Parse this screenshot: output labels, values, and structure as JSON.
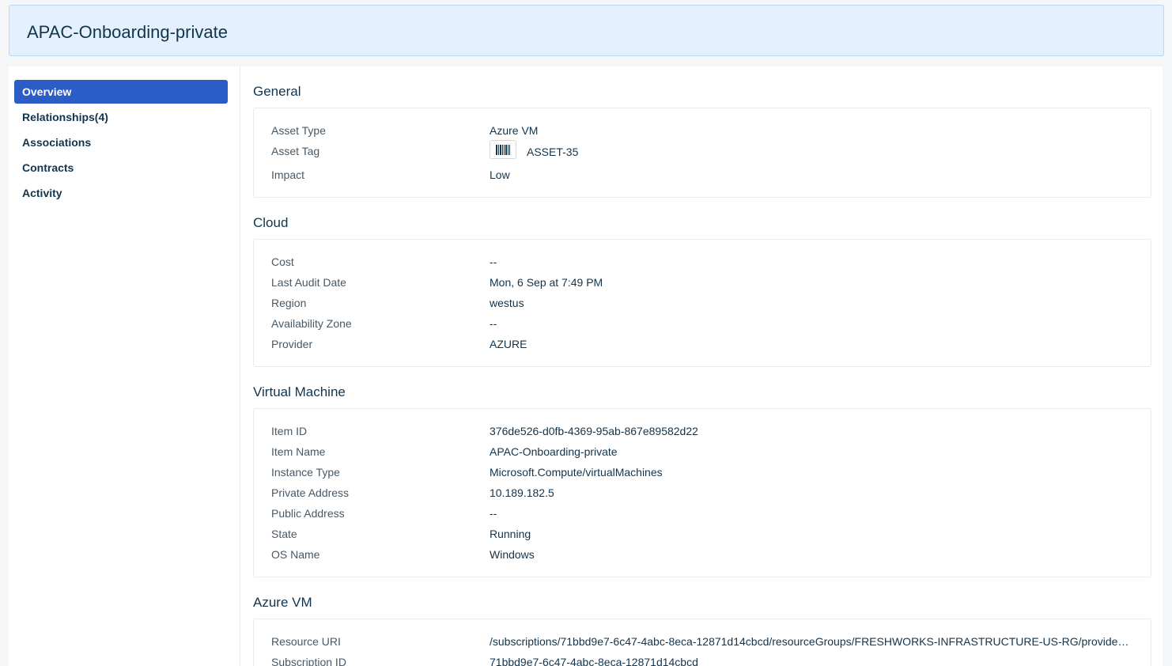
{
  "header": {
    "title": "APAC-Onboarding-private"
  },
  "sidebar": {
    "items": [
      {
        "label": "Overview",
        "active": true
      },
      {
        "label": "Relationships(4)",
        "active": false
      },
      {
        "label": "Associations",
        "active": false
      },
      {
        "label": "Contracts",
        "active": false
      },
      {
        "label": "Activity",
        "active": false
      }
    ]
  },
  "sections": {
    "general": {
      "title": "General",
      "rows": [
        {
          "label": "Asset Type",
          "value": "Azure VM"
        },
        {
          "label": "Asset Tag",
          "value": "ASSET-35",
          "icon": "barcode-icon"
        },
        {
          "label": "Impact",
          "value": "Low"
        }
      ]
    },
    "cloud": {
      "title": "Cloud",
      "rows": [
        {
          "label": "Cost",
          "value": "--"
        },
        {
          "label": "Last Audit Date",
          "value": "Mon, 6 Sep at 7:49 PM"
        },
        {
          "label": "Region",
          "value": "westus"
        },
        {
          "label": "Availability Zone",
          "value": "--"
        },
        {
          "label": "Provider",
          "value": "AZURE"
        }
      ]
    },
    "vm": {
      "title": "Virtual Machine",
      "rows": [
        {
          "label": "Item ID",
          "value": "376de526-d0fb-4369-95ab-867e89582d22"
        },
        {
          "label": "Item Name",
          "value": "APAC-Onboarding-private"
        },
        {
          "label": "Instance Type",
          "value": "Microsoft.Compute/virtualMachines"
        },
        {
          "label": "Private Address",
          "value": "10.189.182.5"
        },
        {
          "label": "Public Address",
          "value": "--"
        },
        {
          "label": "State",
          "value": "Running"
        },
        {
          "label": "OS Name",
          "value": "Windows"
        }
      ]
    },
    "azure": {
      "title": "Azure VM",
      "rows": [
        {
          "label": "Resource URI",
          "value": "/subscriptions/71bbd9e7-6c47-4abc-8eca-12871d14cbcd/resourceGroups/FRESHWORKS-INFRASTRUCTURE-US-RG/providers/..."
        },
        {
          "label": "Subscription ID",
          "value": "71bbd9e7-6c47-4abc-8eca-12871d14cbcd"
        }
      ]
    }
  },
  "colors": {
    "accent": "#2c5cc5",
    "header_bg": "#e4f0fd",
    "text": "#12344d"
  }
}
